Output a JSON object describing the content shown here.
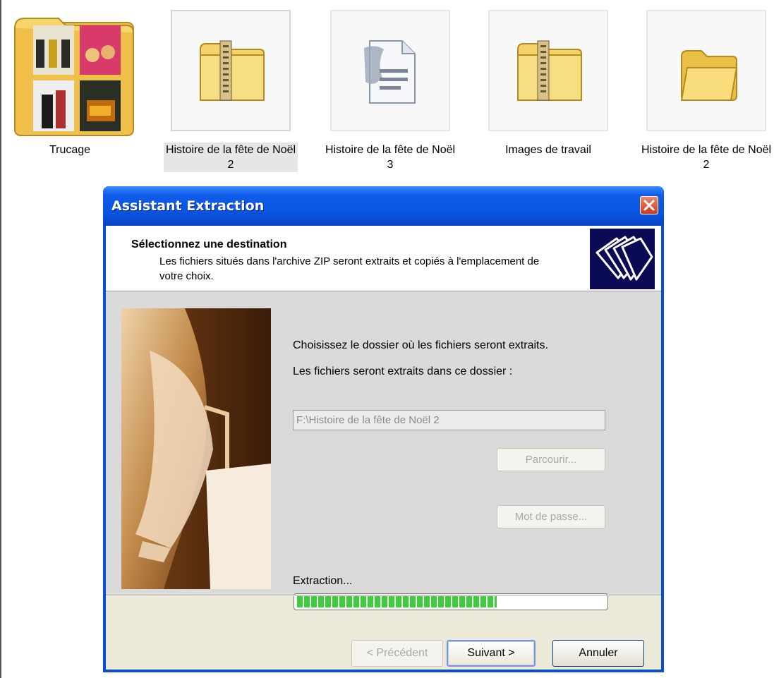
{
  "explorer": {
    "items": [
      {
        "label": "Trucage",
        "icon": "folder-with-thumbnails-icon"
      },
      {
        "label": "Histoire de la fête de Noël 2",
        "icon": "zip-folder-icon",
        "selected": true
      },
      {
        "label": "Histoire de la fête de Noël 3",
        "icon": "document-icon"
      },
      {
        "label": "Images de travail",
        "icon": "zip-folder-icon"
      },
      {
        "label": "Histoire de la fête de Noël 2",
        "icon": "folder-icon"
      }
    ]
  },
  "dialog": {
    "title": "Assistant Extraction",
    "close_icon": "close-icon",
    "header": {
      "title": "Sélectionnez une destination",
      "description": "Les fichiers situés dans l'archive ZIP seront extraits et copiés à l'emplacement de votre choix.",
      "icon": "folders-icon"
    },
    "choose_text": "Choisissez le dossier où les fichiers seront extraits.",
    "dest_label": "Les fichiers seront extraits dans ce dossier :",
    "dest_path": "F:\\Histoire de la fête de Noël 2",
    "browse_button": "Parcourir...",
    "password_button": "Mot de passe...",
    "progress_label": "Extraction...",
    "progress_fraction": 0.65,
    "buttons": {
      "previous": "< Précédent",
      "next": "Suivant >",
      "cancel": "Annuler"
    }
  },
  "colors": {
    "title_bar": "#0a56e4",
    "progress_fill": "#3ccf3c",
    "dialog_body": "#dadadb"
  }
}
